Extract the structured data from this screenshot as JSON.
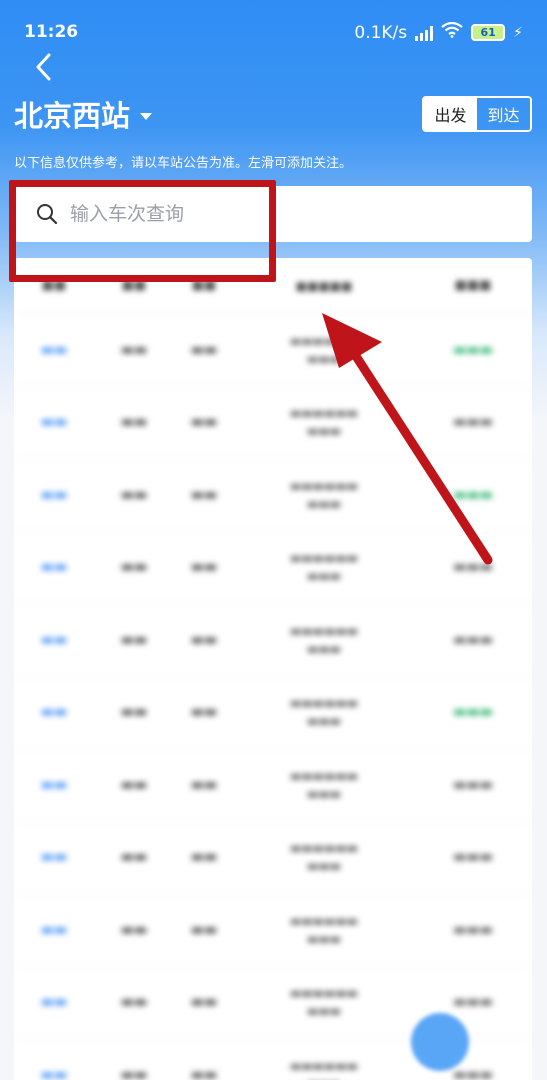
{
  "status_bar": {
    "time": "11:26",
    "net_speed": "0.1K/s",
    "battery": "61"
  },
  "header": {
    "back_icon": "chevron-left-icon",
    "station_name": "北京西站",
    "toggle": {
      "depart": "出发",
      "arrive": "到达",
      "selected": "depart"
    },
    "notice": "以下信息仅供参考，请以车站公告为准。左滑可添加关注。"
  },
  "search": {
    "placeholder": "输入车次查询",
    "value": ""
  },
  "colors": {
    "brand_blue": "#2f8df4",
    "status_green": "#22b068",
    "annotation_red": "#c0141b"
  },
  "table": {
    "row_count": 11
  },
  "annotation": {
    "type": "red-box-with-arrow",
    "target": "search-input"
  }
}
